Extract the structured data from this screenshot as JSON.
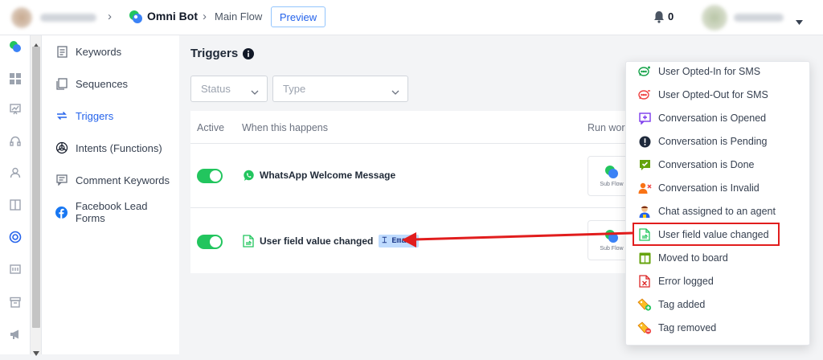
{
  "breadcrumb": {
    "bot_name": "Omni Bot",
    "flow_name": "Main Flow",
    "preview_label": "Preview"
  },
  "header": {
    "notification_count": "0"
  },
  "sidebar": {
    "items": [
      {
        "label": "Keywords"
      },
      {
        "label": "Sequences"
      },
      {
        "label": "Triggers"
      },
      {
        "label": "Intents (Functions)"
      },
      {
        "label": "Comment Keywords"
      },
      {
        "label": "Facebook Lead Forms"
      }
    ]
  },
  "main": {
    "title": "Triggers",
    "filters": {
      "status_placeholder": "Status",
      "type_placeholder": "Type"
    },
    "table": {
      "headers": {
        "active": "Active",
        "when": "When this happens",
        "run": "Run wor"
      },
      "rows": [
        {
          "trigger": "WhatsApp Welcome Message",
          "flow_label": "Sub Flow",
          "active": true
        },
        {
          "trigger": "User field value changed",
          "field_chip": "Email",
          "flow_label": "Sub Flow",
          "active": true
        }
      ]
    }
  },
  "dropdown": {
    "items": [
      {
        "label": "User Opted-In for SMS",
        "icon": "sms-optin-icon"
      },
      {
        "label": "User Opted-Out for SMS",
        "icon": "sms-optout-icon"
      },
      {
        "label": "Conversation is Opened",
        "icon": "conversation-opened-icon"
      },
      {
        "label": "Conversation is Pending",
        "icon": "pending-icon"
      },
      {
        "label": "Conversation is Done",
        "icon": "done-icon"
      },
      {
        "label": "Conversation is Invalid",
        "icon": "invalid-icon"
      },
      {
        "label": "Chat assigned to an agent",
        "icon": "agent-icon"
      },
      {
        "label": "User field value changed",
        "icon": "field-changed-icon"
      },
      {
        "label": "Moved to board",
        "icon": "board-icon"
      },
      {
        "label": "Error logged",
        "icon": "error-icon"
      },
      {
        "label": "Tag added",
        "icon": "tag-added-icon"
      },
      {
        "label": "Tag removed",
        "icon": "tag-removed-icon"
      }
    ]
  },
  "colors": {
    "accent": "#2563eb",
    "toggle_on": "#22c55e",
    "highlight": "#e11d1d"
  }
}
